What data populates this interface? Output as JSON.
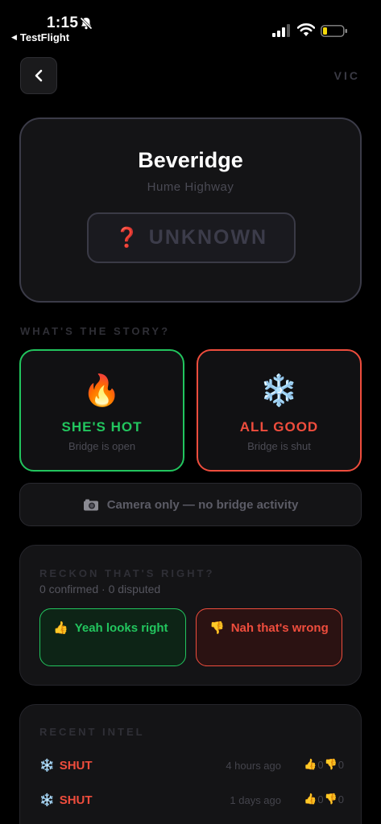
{
  "status_bar": {
    "time": "1:15",
    "back_app": "TestFlight"
  },
  "nav": {
    "region": "VIC"
  },
  "bridge": {
    "name": "Beveridge",
    "road": "Hume Highway",
    "status_icon": "❓",
    "status_text": "UNKNOWN"
  },
  "story": {
    "label": "WHAT'S THE STORY?",
    "hot": {
      "emoji": "🔥",
      "title": "SHE'S HOT",
      "sub": "Bridge is open"
    },
    "good": {
      "emoji": "❄️",
      "title": "ALL GOOD",
      "sub": "Bridge is shut"
    },
    "camera": {
      "icon": "camera-icon",
      "text": "Camera only — no bridge activity"
    }
  },
  "confirm": {
    "label": "RECKON THAT'S RIGHT?",
    "counts": "0 confirmed · 0 disputed",
    "yes": {
      "emoji": "👍",
      "text": "Yeah looks right"
    },
    "no": {
      "emoji": "👎",
      "text": "Nah that's wrong"
    }
  },
  "recent": {
    "label": "RECENT INTEL",
    "items": [
      {
        "emoji": "❄️",
        "status": "SHUT",
        "ago": "4 hours ago",
        "up": "0",
        "down": "0"
      },
      {
        "emoji": "❄️",
        "status": "SHUT",
        "ago": "1 days ago",
        "up": "0",
        "down": "0"
      }
    ]
  },
  "colors": {
    "hot": "#22c55e",
    "good": "#ef4d3d",
    "background": "#000000"
  }
}
